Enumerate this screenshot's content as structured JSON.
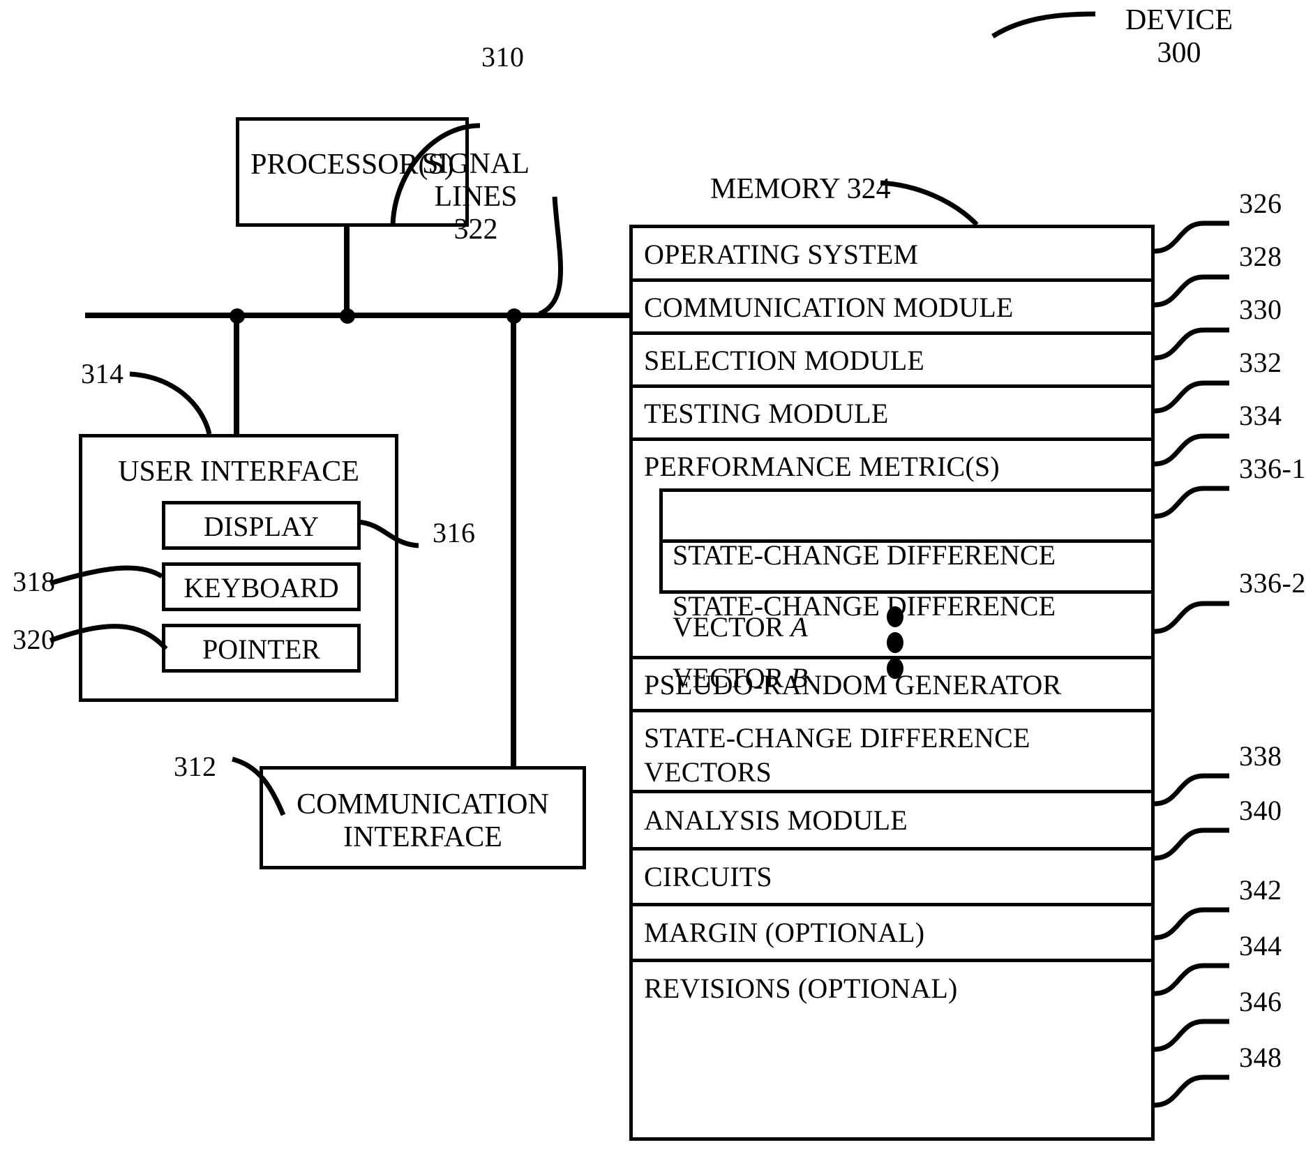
{
  "figure": {
    "device_label": "DEVICE",
    "device_number": "300"
  },
  "blocks": {
    "processor": {
      "label": "PROCESSOR(S)",
      "ref": "310"
    },
    "signal_lines": {
      "label_line1": "SIGNAL",
      "label_line2": "LINES",
      "ref": "322"
    },
    "user_interface": {
      "label": "USER INTERFACE",
      "ref": "314"
    },
    "display": {
      "label": "DISPLAY",
      "ref": "316"
    },
    "keyboard": {
      "label": "KEYBOARD",
      "ref": "318"
    },
    "pointer": {
      "label": "POINTER",
      "ref": "320"
    },
    "communication_interface": {
      "label_line1": "COMMUNICATION",
      "label_line2": "INTERFACE",
      "ref": "312"
    }
  },
  "memory": {
    "title": "MEMORY 324",
    "rows": [
      {
        "label": "OPERATING SYSTEM",
        "ref": "326"
      },
      {
        "label": "COMMUNICATION MODULE",
        "ref": "328"
      },
      {
        "label": "SELECTION MODULE",
        "ref": "330"
      },
      {
        "label": "TESTING MODULE",
        "ref": "332"
      },
      {
        "label": "PERFORMANCE METRIC(S)",
        "ref": "334"
      },
      {
        "label": "PSEUDO-RANDOM GENERATOR",
        "ref": "338"
      },
      {
        "label": "STATE-CHANGE DIFFERENCE\nVECTORS",
        "ref": "340"
      },
      {
        "label": "ANALYSIS MODULE",
        "ref": "342"
      },
      {
        "label": "CIRCUITS",
        "ref": "344"
      },
      {
        "label": "MARGIN (OPTIONAL)",
        "ref": "346"
      },
      {
        "label": "REVISIONS (OPTIONAL)",
        "ref": "348"
      }
    ],
    "nested_vectors": [
      {
        "line1": "STATE-CHANGE DIFFERENCE",
        "line2_prefix": "VECTOR ",
        "line2_italic": "A",
        "ref": "336-1"
      },
      {
        "line1": "STATE-CHANGE DIFFERENCE",
        "line2_prefix": "VECTOR ",
        "line2_italic": "B",
        "ref": "336-2"
      }
    ],
    "ellipsis_note": "vertical ellipsis indicating additional state-change difference vectors"
  },
  "colors": {
    "stroke": "#000000",
    "background": "#ffffff"
  }
}
